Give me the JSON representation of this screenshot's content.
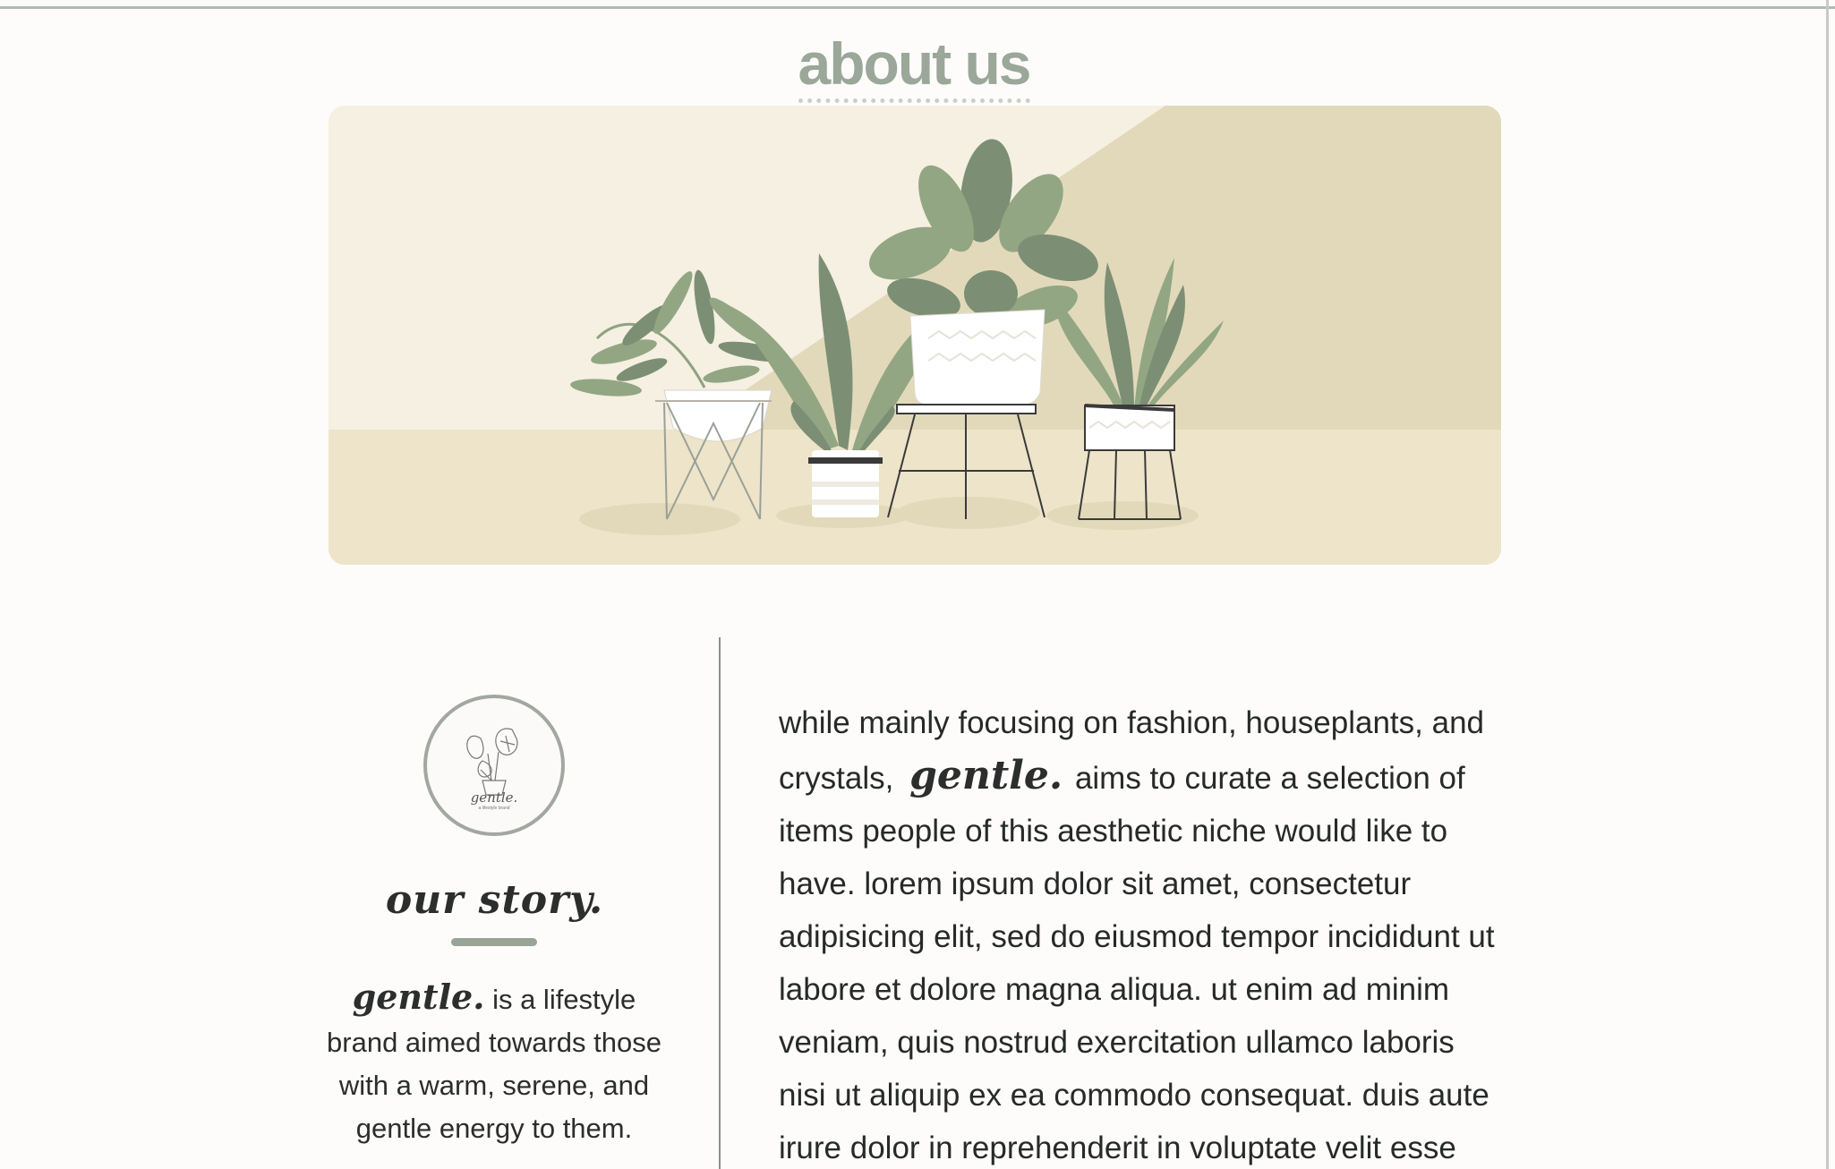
{
  "page": {
    "title": "about us"
  },
  "banner": {
    "alt": "illustration of four houseplants on plant stands",
    "colors": {
      "wall": "#f5f0e1",
      "wall_shadow": "#e2d9bb",
      "floor": "#ede4c9",
      "leaf_dark": "#7c8f74",
      "leaf_light": "#93a684",
      "pot": "#ffffff"
    }
  },
  "sidebar": {
    "logo": {
      "icon": "monstera-plant-logo-icon",
      "wordmark": "gentle.",
      "tagline": "a lifestyle brand"
    },
    "heading": "our story.",
    "brand": "gentle.",
    "intro": "is a lifestyle brand aimed towards those with a warm, serene, and gentle energy to them."
  },
  "main": {
    "lead_before": "while mainly focusing on fashion, houseplants, and crystals,",
    "brand": "gentle.",
    "lead_after": "aims to curate a selection of items people of this aesthetic niche would like to have.",
    "body": "lorem ipsum dolor sit amet, consectetur adipisicing elit, sed do eiusmod tempor incididunt ut labore et dolore magna aliqua. ut enim ad minim veniam, quis nostrud exercitation ullamco laboris nisi ut aliquip ex ea commodo consequat. duis aute irure dolor in reprehenderit in voluptate velit esse cillum dolore"
  },
  "theme": {
    "background": "#fdfcfb",
    "accent": "#98a496",
    "text": "#2b2e2c"
  }
}
